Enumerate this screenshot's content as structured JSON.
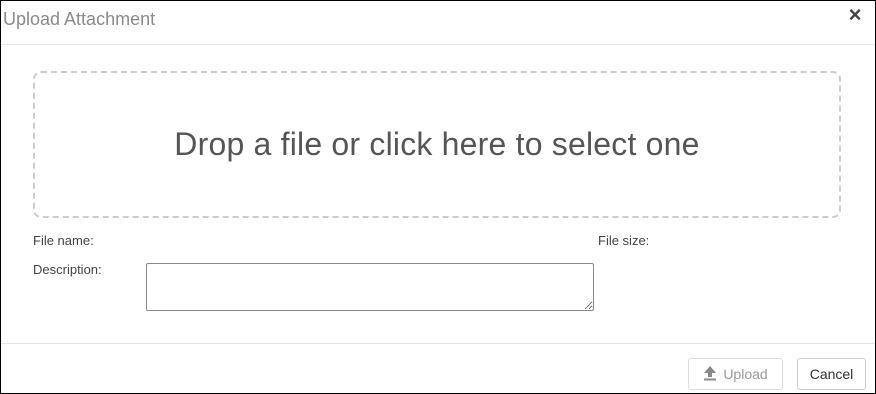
{
  "dialog": {
    "title": "Upload Attachment",
    "close_symbol": "×"
  },
  "dropzone": {
    "text": "Drop a file or click here to select one"
  },
  "fields": {
    "file_name_label": "File name:",
    "file_size_label": "File size:",
    "description_label": "Description:",
    "description_value": ""
  },
  "footer": {
    "upload_label": "Upload",
    "upload_icon": "upload-icon",
    "cancel_label": "Cancel"
  },
  "colors": {
    "title": "#8a8a8a",
    "dropzone_border": "#cccccc",
    "upload_disabled_text": "#999999"
  }
}
